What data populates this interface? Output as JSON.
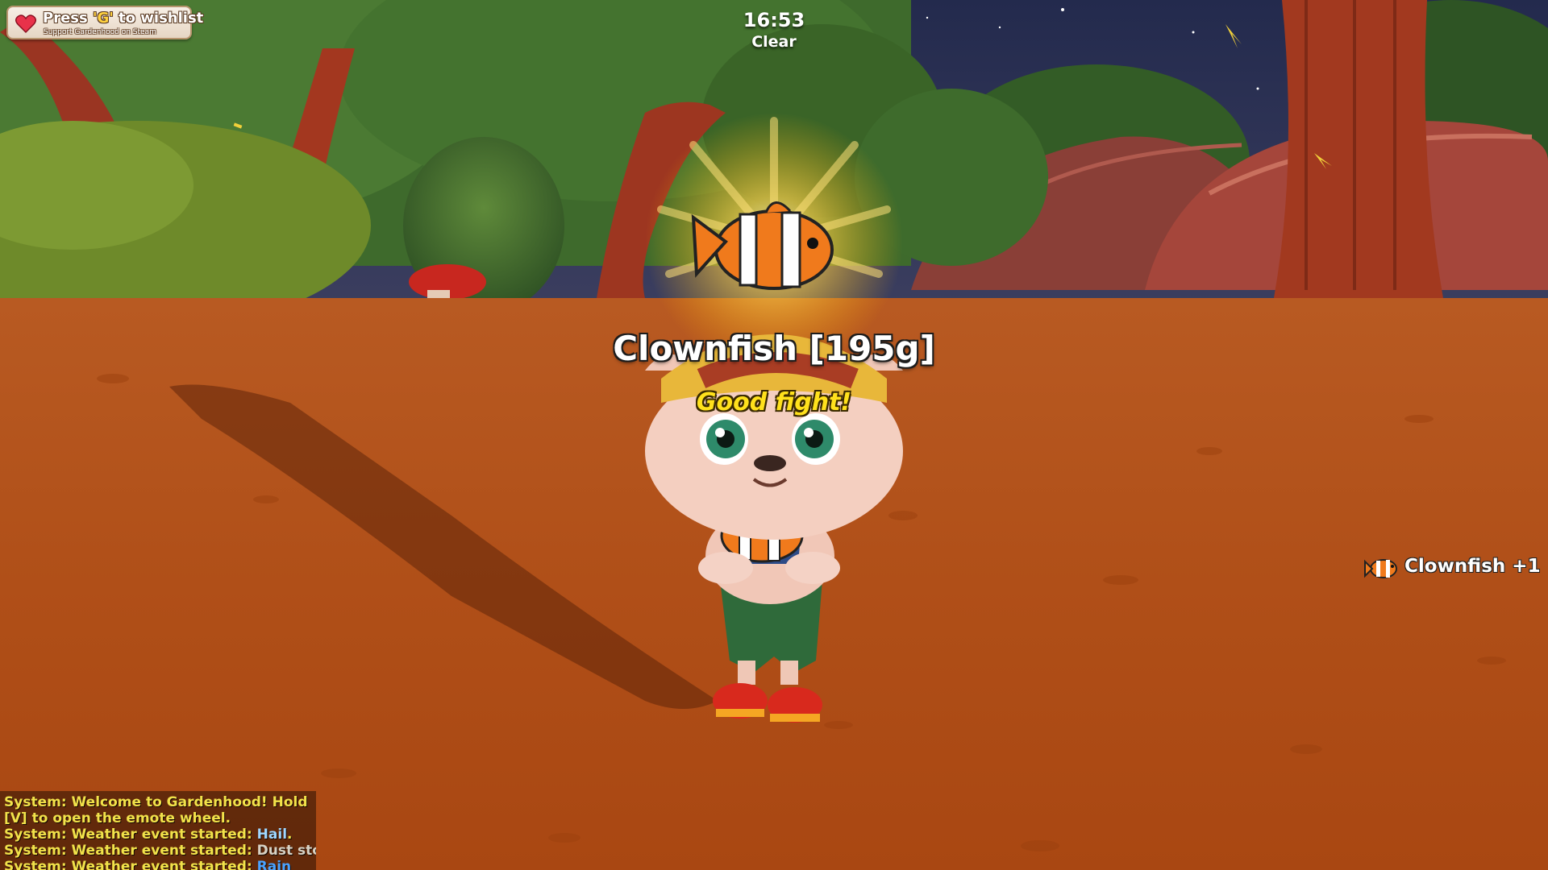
{
  "hud": {
    "wishlist": {
      "prefix": "Press ",
      "key": "'G'",
      "suffix": " to wishlist",
      "subtitle": "Support Gardenhood on Steam",
      "icon": "heart-icon",
      "heart_color": "#e8324a"
    },
    "clock": {
      "time": "16:53",
      "weather": "Clear"
    }
  },
  "catch_popup": {
    "title": "Clownfish [195g]",
    "subtitle": "Good fight!",
    "icon": "clownfish-icon"
  },
  "notification": {
    "icon": "clownfish-icon",
    "text": "Clownfish +1"
  },
  "chat": {
    "messages": [
      {
        "text": "System: Welcome to Gardenhood! Hold [V] to open the emote wheel."
      },
      {
        "text": "System: Weather event started: ",
        "highlight": "Hail",
        "end": ".",
        "highlight_color": "#9fd6ff"
      },
      {
        "text": "System: Weather event started: ",
        "highlight": "Dust storm",
        "end": ".",
        "highlight_color": "#d8d2c4"
      },
      {
        "text": "System: Weather event started: ",
        "highlight": "Rain",
        "end": "",
        "highlight_color": "#4aa3ff"
      }
    ]
  },
  "colors": {
    "ground": "#b5541c",
    "sky": "#2d3257",
    "chat_text": "#f2e24a",
    "popup_subtitle": "#ffe11c"
  }
}
